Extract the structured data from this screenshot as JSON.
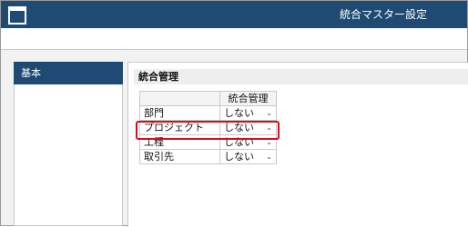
{
  "window": {
    "title": "統合マスター設定",
    "icon": "window-icon",
    "title_bar_color": "#1e4a73"
  },
  "sidebar": {
    "items": [
      {
        "label": "基本",
        "active": true
      }
    ]
  },
  "panel": {
    "title": "統合管理"
  },
  "table": {
    "header": {
      "name": "",
      "value": "統合管理"
    },
    "rows": [
      {
        "name": "部門",
        "value": "しない",
        "icon": "chevron-down-icon"
      },
      {
        "name": "プロジェクト",
        "value": "しない",
        "icon": "chevron-down-icon",
        "highlighted": true
      },
      {
        "name": "工程",
        "value": "しない",
        "icon": "chevron-down-icon"
      },
      {
        "name": "取引先",
        "value": "しない",
        "icon": "chevron-down-icon"
      }
    ]
  },
  "highlight_color": "#d0101b"
}
